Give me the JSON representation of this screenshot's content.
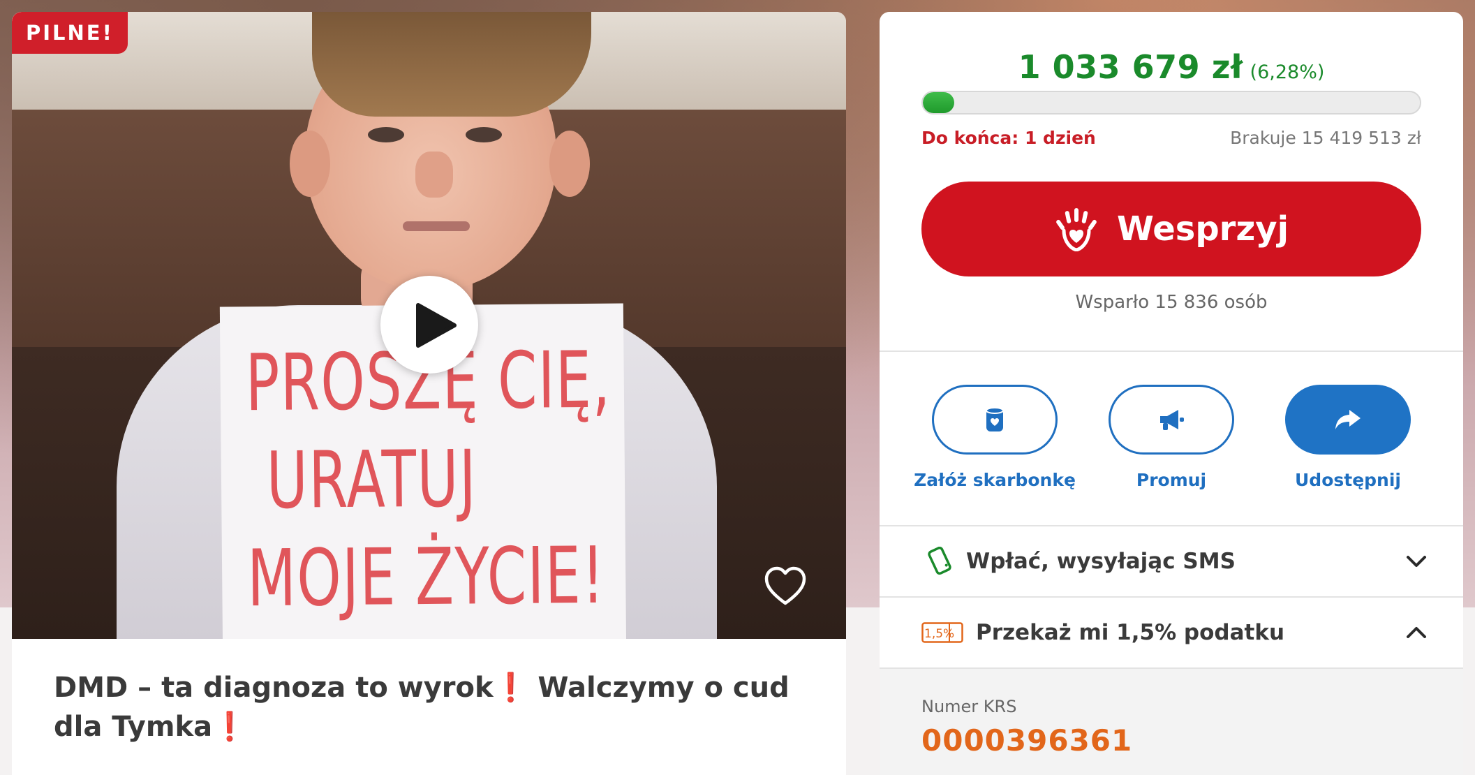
{
  "story": {
    "badge": "PILNE!",
    "sign_text": [
      "PROSZĘ CIĘ,",
      "URATUJ",
      "MOJE ŻYCIE!"
    ],
    "title_part1": "DMD – ta diagnoza to wyrok",
    "title_part2": " Walczymy o cud dla Tymka",
    "title_emphasis": "❗"
  },
  "donation": {
    "amount": "1 033 679 zł",
    "percent": "(6,28%)",
    "progress": 6.28,
    "deadline": "Do końca: 1 dzień",
    "missing": "Brakuje 15 419 513 zł",
    "support_label": "Wesprzyj",
    "supporters": "Wsparło 15 836 osób"
  },
  "actions": [
    {
      "label": "Załóż skarbonkę",
      "icon": "piggy-bank-icon"
    },
    {
      "label": "Promuj",
      "icon": "megaphone-icon"
    },
    {
      "label": "Udostępnij",
      "icon": "share-icon"
    }
  ],
  "accordions": {
    "sms": {
      "label": "Wpłać, wysyłając SMS",
      "icon": "phone-icon",
      "state": "collapsed"
    },
    "tax": {
      "label": "Przekaż mi 1,5% podatku",
      "icon": "tax-percent-icon",
      "icon_text": "1,5%",
      "state": "expanded"
    }
  },
  "krs": {
    "label": "Numer KRS",
    "number": "0000396361"
  },
  "colors": {
    "brand_red": "#d0131f",
    "amount_green": "#1a8a2b",
    "action_blue": "#1f73c5",
    "krs_orange": "#e2661a"
  }
}
